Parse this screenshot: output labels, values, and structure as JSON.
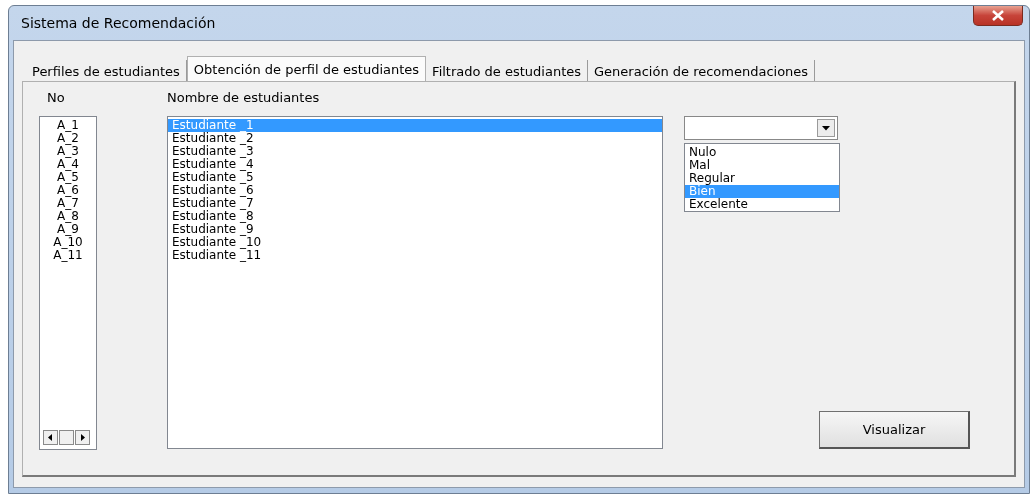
{
  "window": {
    "title": "Sistema de Recomendación"
  },
  "tabs": [
    {
      "label": "Perfiles de estudiantes",
      "selected": false
    },
    {
      "label": "Obtención de perfil de estudiantes",
      "selected": true
    },
    {
      "label": "Filtrado de estudiantes",
      "selected": false
    },
    {
      "label": "Generación de recomendaciones",
      "selected": false
    }
  ],
  "headers": [
    "No",
    "Nombre de estudiantes"
  ],
  "number_list": [
    "A_1",
    "A_2",
    "A_3",
    "A_4",
    "A_5",
    "A_6",
    "A_7",
    "A_8",
    "A_9",
    "A_10",
    "A_11"
  ],
  "student_list": [
    {
      "label": "Estudiante _1",
      "selected": true
    },
    {
      "label": "Estudiante _2",
      "selected": false
    },
    {
      "label": "Estudiante _3",
      "selected": false
    },
    {
      "label": "Estudiante _4",
      "selected": false
    },
    {
      "label": "Estudiante _5",
      "selected": false
    },
    {
      "label": "Estudiante _6",
      "selected": false
    },
    {
      "label": "Estudiante _7",
      "selected": false
    },
    {
      "label": "Estudiante _8",
      "selected": false
    },
    {
      "label": "Estudiante _9",
      "selected": false
    },
    {
      "label": "Estudiante _10",
      "selected": false
    },
    {
      "label": "Estudiante _11",
      "selected": false
    }
  ],
  "combo": {
    "expanded": true,
    "options": [
      {
        "label": "Nulo",
        "selected": false
      },
      {
        "label": "Mal",
        "selected": false
      },
      {
        "label": "Regular",
        "selected": false
      },
      {
        "label": "Bien",
        "selected": true
      },
      {
        "label": "Excelente",
        "selected": false
      }
    ]
  },
  "button": "Visualizar"
}
